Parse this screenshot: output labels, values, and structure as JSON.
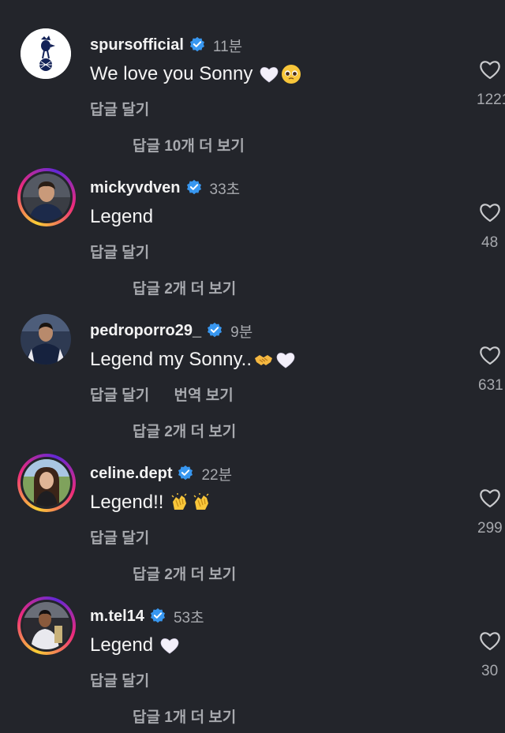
{
  "colors": {
    "background": "#23252b",
    "secondary_text": "#a7a9ae",
    "verified_blue": "#3897f0"
  },
  "comments": [
    {
      "username": "spursofficial",
      "verified": true,
      "time": "11분",
      "text": "We love you Sonny",
      "emojis": [
        "white-heart",
        "pleading-face"
      ],
      "reply_label": "답글 달기",
      "translate_label": "",
      "more_replies": "답글 10개 더 보기",
      "likes": "1221",
      "avatar": "tottenham-crest"
    },
    {
      "username": "mickyvdven",
      "verified": true,
      "time": "33초",
      "text": "Legend",
      "emojis": [],
      "reply_label": "답글 달기",
      "translate_label": "",
      "more_replies": "답글 2개 더 보기",
      "likes": "48",
      "avatar": "profile-photo"
    },
    {
      "username": "pedroporro29_",
      "verified": true,
      "time": "9분",
      "text": "Legend my Sonny..",
      "emojis": [
        "handshake",
        "white-heart"
      ],
      "reply_label": "답글 달기",
      "translate_label": "번역 보기",
      "more_replies": "답글 2개 더 보기",
      "likes": "631",
      "avatar": "profile-photo"
    },
    {
      "username": "celine.dept",
      "verified": true,
      "time": "22분",
      "text": "Legend!!",
      "emojis": [
        "clapping-hands",
        "clapping-hands"
      ],
      "reply_label": "답글 달기",
      "translate_label": "",
      "more_replies": "답글 2개 더 보기",
      "likes": "299",
      "avatar": "profile-photo"
    },
    {
      "username": "m.tel14",
      "verified": true,
      "time": "53초",
      "text": "Legend",
      "emojis": [
        "white-heart"
      ],
      "reply_label": "답글 달기",
      "translate_label": "",
      "more_replies": "답글 1개 더 보기",
      "likes": "30",
      "avatar": "profile-photo"
    }
  ]
}
